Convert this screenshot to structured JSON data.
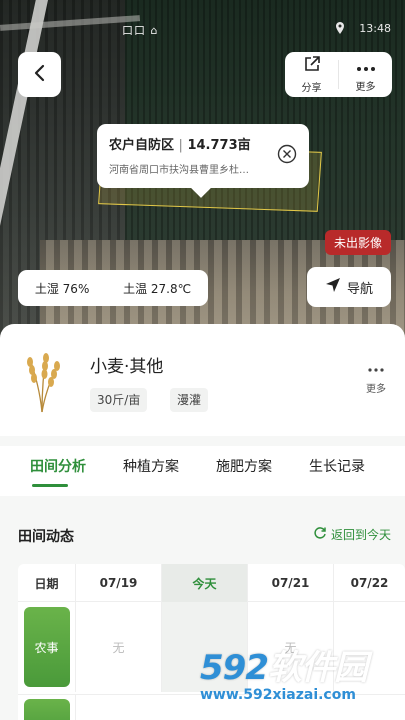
{
  "status_bar": {
    "left": "口口 ⌂",
    "location_icon": "location-icon",
    "time": "13:48"
  },
  "map": {
    "back_icon": "chevron-left-icon",
    "share": {
      "label": "分享",
      "icon": "share-icon"
    },
    "more": {
      "label": "更多",
      "icon": "more-dots-icon"
    },
    "popup": {
      "name": "农户自防区",
      "separator": "|",
      "area": "14.773亩",
      "address": "河南省周口市扶沟县曹里乡杜…",
      "close_icon": "close-circle-icon"
    },
    "badge_no_image": "未出影像",
    "soil": {
      "moisture": "土湿 76%",
      "temperature": "土温 27.8℃"
    },
    "navigate": {
      "label": "导航",
      "icon": "navigation-arrow-icon"
    }
  },
  "crop": {
    "image_icon": "wheat-icon",
    "name": "小麦·其他",
    "tags": [
      "30斤/亩",
      "漫灌"
    ],
    "more_label": "更多"
  },
  "tabs": {
    "items": [
      "田间分析",
      "种植方案",
      "施肥方案",
      "生长记录"
    ],
    "active_index": 0
  },
  "panel": {
    "title": "田间动态",
    "back_today_label": "返回到今天",
    "back_today_icon": "refresh-icon",
    "table": {
      "header": [
        "日期",
        "07/19",
        "今天",
        "07/21",
        "07/22"
      ],
      "rows": [
        {
          "label": "农事",
          "cells": [
            "无",
            "",
            "无",
            ""
          ]
        }
      ]
    }
  },
  "watermark": {
    "num": "592",
    "name": "软件园",
    "url": "www.592xiazai.com"
  },
  "colors": {
    "accent": "#2f8f3b",
    "badge": "#b82a2a",
    "watermark": "#2f8fd6"
  }
}
